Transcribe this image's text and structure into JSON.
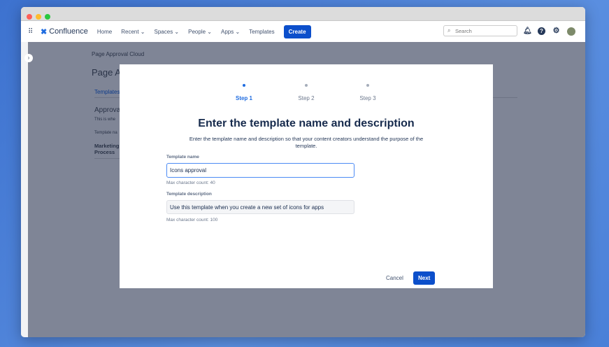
{
  "nav": {
    "product": "Confluence",
    "items": [
      "Home",
      "Recent",
      "Spaces",
      "People",
      "Apps",
      "Templates"
    ],
    "create": "Create",
    "search_placeholder": "Search"
  },
  "background": {
    "breadcrumb": "Page Approval Cloud",
    "title": "Page A",
    "tab": "Templates",
    "section": "Approva",
    "section_desc": "This is whe",
    "col": "Template na",
    "row": "Marketing Process"
  },
  "modal": {
    "steps": [
      "Step 1",
      "Step 2",
      "Step 3"
    ],
    "active_step": 1,
    "title": "Enter the template name and description",
    "description": "Enter the template name and description so that your content creators understand the purpose of the template.",
    "name_label": "Template name",
    "name_value": "Icons approval",
    "name_hint": "Max character count: 40",
    "desc_label": "Template description",
    "desc_value": "Use this template when you create a new set of icons for apps",
    "desc_hint": "Max character count: 100",
    "cancel": "Cancel",
    "next": "Next"
  },
  "colors": {
    "accent": "#0c4fcb"
  }
}
